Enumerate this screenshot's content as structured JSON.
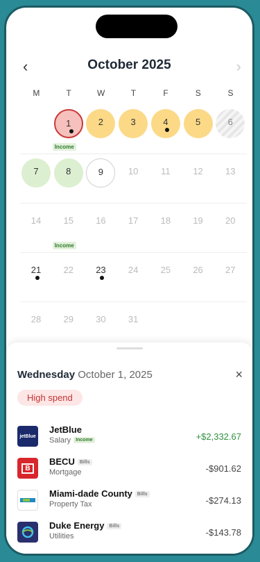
{
  "calendar": {
    "month_title": "October 2025",
    "prev_icon": "chevron-left-icon",
    "next_icon": "chevron-right-icon",
    "weekdays": [
      "M",
      "T",
      "W",
      "T",
      "F",
      "S",
      "S"
    ],
    "weeks": [
      [
        {
          "d": ""
        },
        {
          "d": "1",
          "s": "income",
          "dot": true,
          "tag": "Income"
        },
        {
          "d": "2",
          "s": "bills"
        },
        {
          "d": "3",
          "s": "bills"
        },
        {
          "d": "4",
          "s": "bills",
          "dot": true
        },
        {
          "d": "5",
          "s": "bills"
        },
        {
          "d": "6",
          "s": "hatched"
        }
      ],
      [
        {
          "d": "7",
          "s": "green"
        },
        {
          "d": "8",
          "s": "green"
        },
        {
          "d": "9",
          "s": "today"
        },
        {
          "d": "10",
          "s": "future"
        },
        {
          "d": "11",
          "s": "future"
        },
        {
          "d": "12",
          "s": "future"
        },
        {
          "d": "13",
          "s": "future"
        }
      ],
      [
        {
          "d": "14",
          "s": "future"
        },
        {
          "d": "15",
          "s": "future",
          "tag": "Income"
        },
        {
          "d": "16",
          "s": "future"
        },
        {
          "d": "17",
          "s": "future"
        },
        {
          "d": "18",
          "s": "future"
        },
        {
          "d": "19",
          "s": "future"
        },
        {
          "d": "20",
          "s": "future"
        }
      ],
      [
        {
          "d": "21",
          "dot": true
        },
        {
          "d": "22",
          "s": "future"
        },
        {
          "d": "23",
          "dot": true
        },
        {
          "d": "24",
          "s": "future"
        },
        {
          "d": "25",
          "s": "future"
        },
        {
          "d": "26",
          "s": "future"
        },
        {
          "d": "27",
          "s": "future"
        }
      ],
      [
        {
          "d": "28",
          "s": "future"
        },
        {
          "d": "29",
          "s": "future"
        },
        {
          "d": "30",
          "s": "future"
        },
        {
          "d": "31",
          "s": "future"
        },
        {
          "d": ""
        },
        {
          "d": ""
        },
        {
          "d": ""
        }
      ]
    ]
  },
  "detail": {
    "weekday": "Wednesday",
    "date": "October 1, 2025",
    "close_label": "×",
    "badge": "High spend",
    "transactions": [
      {
        "name": "JetBlue",
        "sub": "Salary",
        "tag": "Income",
        "tag_type": "income",
        "amount": "+$2,332.67",
        "positive": true,
        "logo_text": "jetBlue",
        "logo_bg": "#1b2a6b"
      },
      {
        "name": "BECU",
        "sub": "Mortgage",
        "tag": "Bills",
        "tag_type": "bills",
        "amount": "-$901.62",
        "positive": false,
        "logo_text": "B",
        "logo_bg": "#d8262c"
      },
      {
        "name": "Miami-dade County",
        "sub": "Property Tax",
        "tag": "Bills",
        "tag_type": "bills",
        "amount": "-$274.13",
        "positive": false,
        "logo_text": "",
        "logo_bg": "#ffffff"
      },
      {
        "name": "Duke Energy",
        "sub": "Utilities",
        "tag": "Bills",
        "tag_type": "bills",
        "amount": "-$143.78",
        "positive": false,
        "logo_text": "",
        "logo_bg": "#2a2f6e"
      }
    ]
  },
  "colors": {
    "accent": "#2a8a95",
    "income_text": "#2e9040",
    "high_spend": "#c43535"
  }
}
